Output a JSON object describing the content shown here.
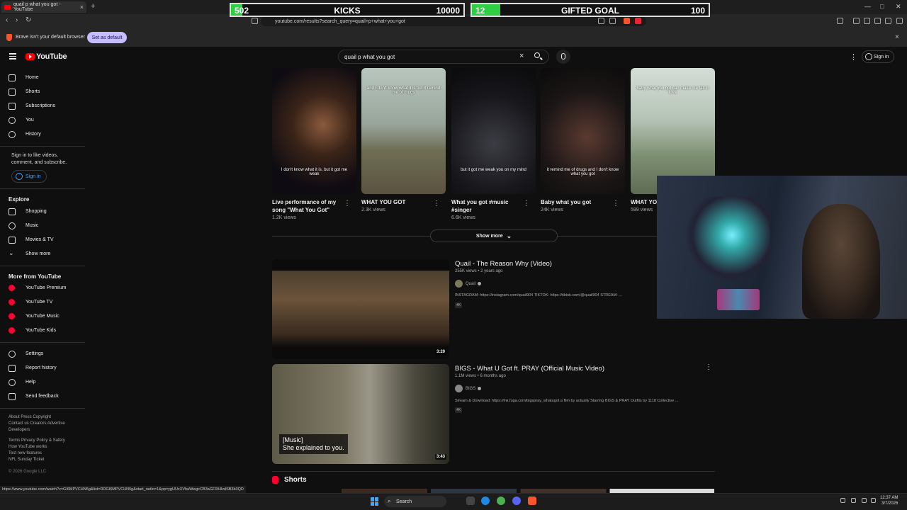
{
  "browser": {
    "tab_title": "quail p what you got - YouTube",
    "tab_close": "×",
    "new_tab": "+",
    "url": "youtube.com/results?search_query=quail+p+what+you+got",
    "infobar_message": "Brave isn't your default browser",
    "set_default_label": "Set as default",
    "infobar_close": "×",
    "status_url": "https://www.youtube.com/watch?v=GI6MPVCHN5g&list=RDGI6MPVCHN5g&start_radio=1&pp=ygUUcXVhaWwgcCB3aGF0IHlvdSB3b3QD"
  },
  "overlay": {
    "kicks": {
      "current": "502",
      "label": "KICKS",
      "target": "10000",
      "progress": 0.05,
      "color": "#2fce45"
    },
    "gifted": {
      "current": "12",
      "label": "GIFTED GOAL",
      "target": "100",
      "progress": 0.12,
      "color": "#2fce45"
    }
  },
  "youtube": {
    "logo_text": "YouTube",
    "search_query": "quail p what you got",
    "clear_icon": "×",
    "menu_icon": "⋮",
    "sign_in": "Sign in"
  },
  "sidebar": {
    "primary": [
      {
        "label": "Home",
        "icon": "home-icon"
      },
      {
        "label": "Shorts",
        "icon": "shorts-icon"
      },
      {
        "label": "Subscriptions",
        "icon": "subscriptions-icon"
      },
      {
        "label": "You",
        "icon": "you-icon"
      },
      {
        "label": "History",
        "icon": "history-icon"
      }
    ],
    "signin_text": "Sign in to like videos, comment, and subscribe.",
    "signin_button": "Sign in",
    "explore_heading": "Explore",
    "explore": [
      {
        "label": "Shopping",
        "icon": "shopping-icon"
      },
      {
        "label": "Music",
        "icon": "music-icon"
      },
      {
        "label": "Movies & TV",
        "icon": "movies-icon"
      },
      {
        "label": "Show more",
        "icon": "chevron-down-icon"
      }
    ],
    "more_heading": "More from YouTube",
    "more": [
      {
        "label": "YouTube Premium",
        "icon": "youtube-premium-icon"
      },
      {
        "label": "YouTube TV",
        "icon": "youtube-tv-icon"
      },
      {
        "label": "YouTube Music",
        "icon": "youtube-music-icon"
      },
      {
        "label": "YouTube Kids",
        "icon": "youtube-kids-icon"
      }
    ],
    "settings": [
      {
        "label": "Settings",
        "icon": "gear-icon"
      },
      {
        "label": "Report history",
        "icon": "flag-icon"
      },
      {
        "label": "Help",
        "icon": "help-icon"
      },
      {
        "label": "Send feedback",
        "icon": "feedback-icon"
      }
    ],
    "footer": {
      "line1": "About  Press  Copyright",
      "line2": "Contact us  Creators  Advertise",
      "line3": "Developers",
      "line4": "Terms  Privacy  Policy & Safety",
      "line5": "How YouTube works",
      "line6": "Test new features",
      "line7": "NFL Sunday Ticket",
      "copyright": "© 2026 Google LLC"
    }
  },
  "shorts": [
    {
      "title": "Live performance of my song \"What You Got\"",
      "views": "1.2K views",
      "caption": "I don't know what it is, but it got me weak"
    },
    {
      "title": "WHAT YOU GOT",
      "views": "2.3K views",
      "caption": "and I don't know what it is but it remind me of drugs"
    },
    {
      "title": "What you got #music #singer",
      "views": "6.6K views",
      "caption": "but it got me weak you on my mind"
    },
    {
      "title": "Baby what you got",
      "views": "24K views",
      "caption": "it remind me of drugs and I don't know what you got"
    },
    {
      "title": "WHAT YOU",
      "views": "599 views",
      "caption": "baby what you got can make me fall in love"
    }
  ],
  "show_more": "Show more",
  "videos": [
    {
      "title": "Quail - The Reason Why (Video)",
      "meta": "255K views • 2 years ago",
      "channel": "Quail",
      "description": "INSTAGRAM: https://instagram.com/quail904 TIKTOK: https://tiktok.com/@quail904 STREAM: ...",
      "badge": "4K",
      "duration": "3:20"
    },
    {
      "title": "BIGS - What U Got ft. PRAY (Official Music Video)",
      "meta": "1.1M views • 6 months ago",
      "channel": "BIGS",
      "description": "Stream & Download: https://lnk.fuga.com/bigspray_whatugot a film by actually Starring BIGS & PRAY Outfits by 1118 Collective ...",
      "badge": "4K",
      "duration": "3:43",
      "subtitle_line1": "[Music]",
      "subtitle_line2": "She explained to you."
    }
  ],
  "shorts_heading": "Shorts",
  "taskbar": {
    "search_label": "Search",
    "time": "12:37 AM",
    "date": "3/7/2026"
  }
}
